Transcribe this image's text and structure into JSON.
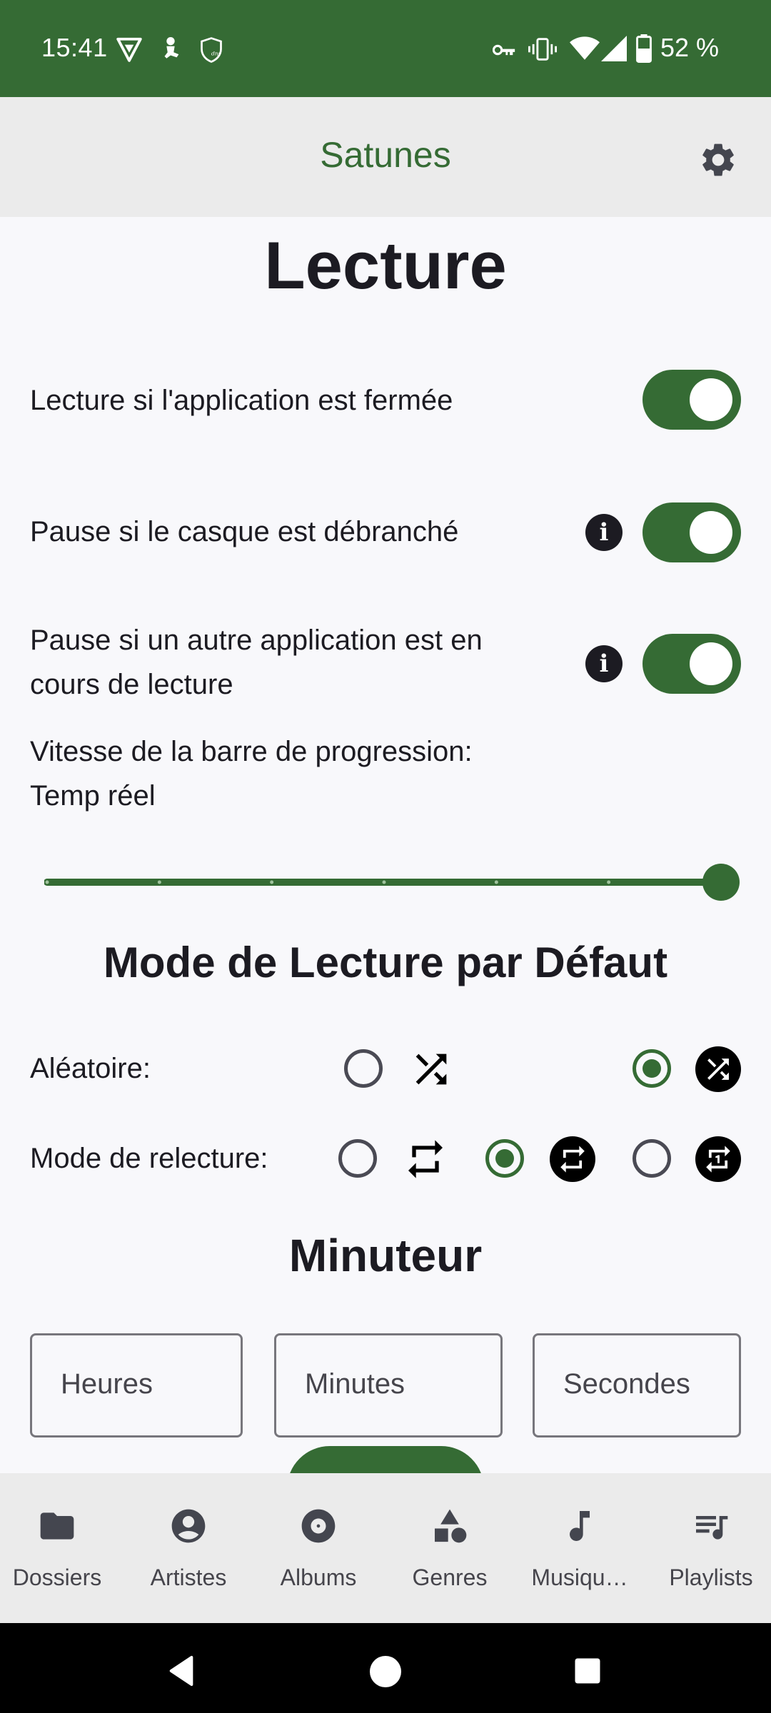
{
  "status_bar": {
    "time": "15:41",
    "left_icons": [
      "vpn-triangle-icon",
      "running-person-icon",
      "dns-shield-icon"
    ],
    "right_icons": [
      "vpn-key-icon",
      "vibrate-icon",
      "wifi-icon",
      "cell-signal-icon",
      "battery-icon"
    ],
    "battery_percent": "52 %"
  },
  "app_bar": {
    "title": "Satunes",
    "settings_icon": "gear-icon"
  },
  "colors": {
    "primary": "#356b34",
    "app_bar_bg": "#ebebeb",
    "background": "#f8f8fb",
    "text": "#1c1b22"
  },
  "section_lecture": {
    "title": "Lecture",
    "settings": [
      {
        "label": "Lecture si l'application est fermée",
        "enabled": true,
        "has_info": false
      },
      {
        "label": "Pause si le casque est débranché",
        "enabled": true,
        "has_info": true
      },
      {
        "label_line1": "Pause si un autre application est en",
        "label_line2": "cours de lecture",
        "enabled": true,
        "has_info": true
      }
    ],
    "progress_speed": {
      "label": "Vitesse de la barre de progression:",
      "value": "Temp réel",
      "slider_steps": 7,
      "slider_value_fraction": 1.0
    }
  },
  "section_mode": {
    "title": "Mode de Lecture par Défaut",
    "shuffle": {
      "label": "Aléatoire:",
      "options": [
        {
          "name": "shuffle-off",
          "icon": "shuffle-icon",
          "selected": false
        },
        {
          "name": "shuffle-on",
          "icon": "shuffle-filled-icon",
          "selected": true
        }
      ]
    },
    "repeat": {
      "label": "Mode de relecture:",
      "options": [
        {
          "name": "repeat-off",
          "icon": "repeat-icon",
          "selected": false
        },
        {
          "name": "repeat-all",
          "icon": "repeat-filled-icon",
          "selected": true
        },
        {
          "name": "repeat-one",
          "icon": "repeat-one-filled-icon",
          "selected": false
        }
      ]
    }
  },
  "section_timer": {
    "title": "Minuteur",
    "fields": [
      {
        "placeholder": "Heures",
        "value": ""
      },
      {
        "placeholder": "Minutes",
        "value": ""
      },
      {
        "placeholder": "Secondes",
        "value": ""
      }
    ]
  },
  "bottom_nav": {
    "items": [
      {
        "label": "Dossiers",
        "icon": "folder-icon"
      },
      {
        "label": "Artistes",
        "icon": "artist-icon"
      },
      {
        "label": "Albums",
        "icon": "album-icon"
      },
      {
        "label": "Genres",
        "icon": "genres-icon"
      },
      {
        "label": "Musiqu…",
        "icon": "music-note-icon"
      },
      {
        "label": "Playlists",
        "icon": "playlist-icon"
      }
    ]
  },
  "system_nav": {
    "buttons": [
      "back",
      "home",
      "recents"
    ]
  }
}
